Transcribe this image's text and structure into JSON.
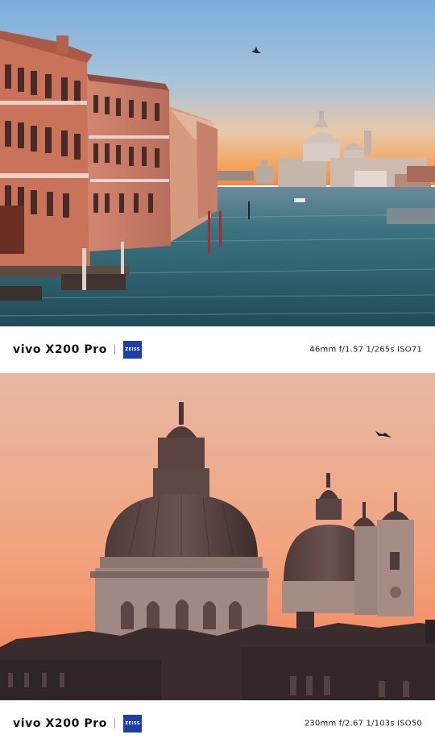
{
  "photos": [
    {
      "brand": "vivo X200 Pro",
      "lens_mark": "ZEISS",
      "exif": "46mm  f/1.57  1/265s  ISO71"
    },
    {
      "brand": "vivo X200 Pro",
      "lens_mark": "ZEISS",
      "exif": "230mm  f/2.67  1/103s  ISO50"
    }
  ],
  "colors": {
    "zeiss_blue": "#1a3fa8",
    "bar_background": "#ffffff",
    "sky_top_1": "#86b3dc",
    "sky_horizon_1": "#f4a25a",
    "water_1": "#2f6472",
    "sky_top_2": "#e9b49e",
    "sky_bottom_2": "#f08a63",
    "silhouette_2": "#3a2a2c"
  }
}
